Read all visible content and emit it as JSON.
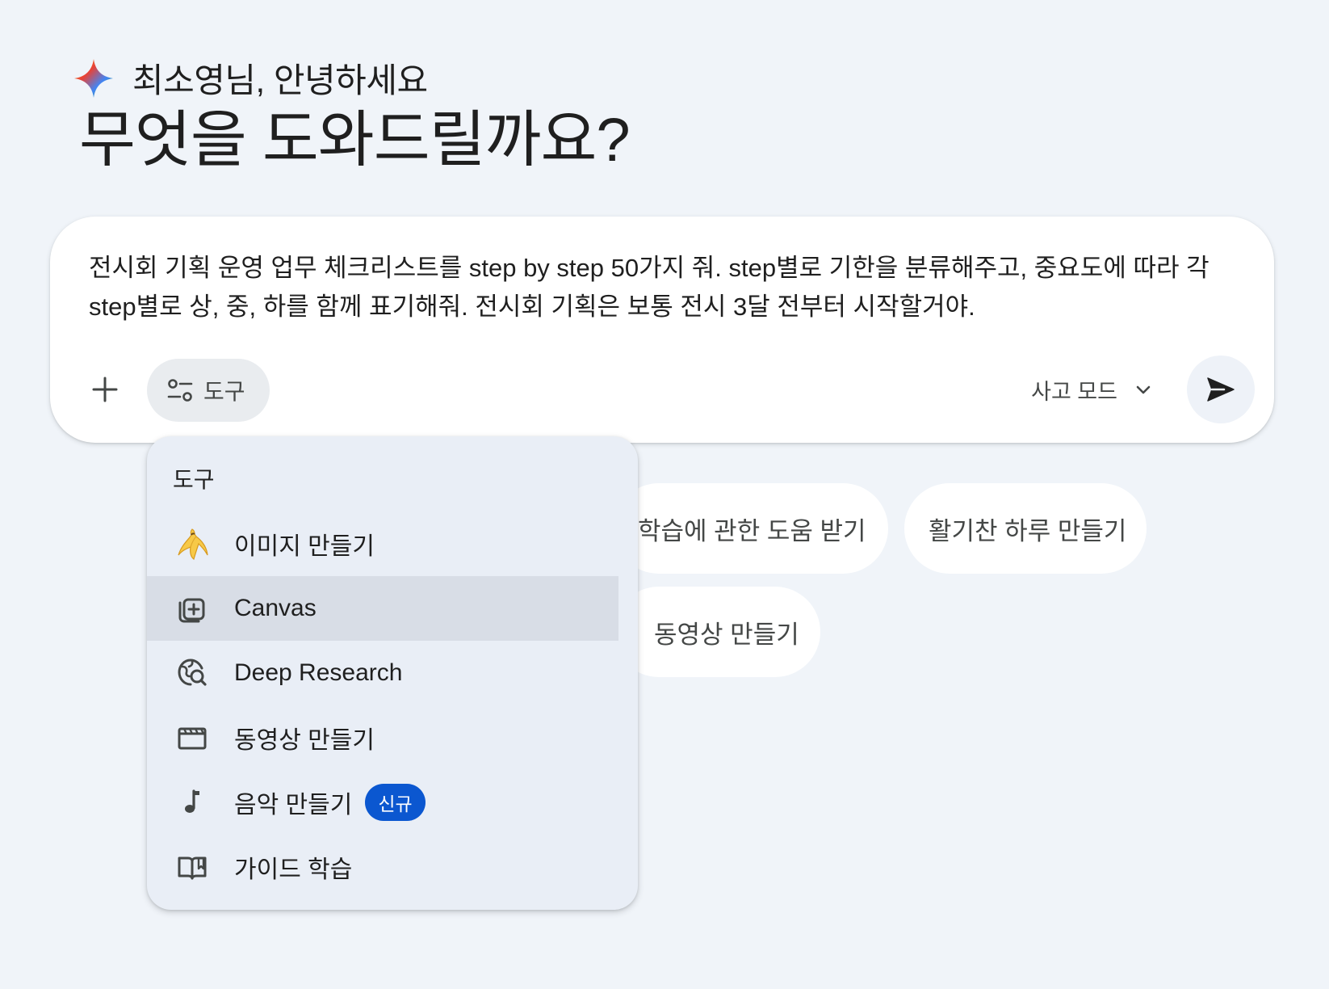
{
  "greeting": {
    "name_line": "최소영님, 안녕하세요",
    "headline": "무엇을 도와드릴까요?"
  },
  "prompt": {
    "text": "전시회 기획 운영 업무 체크리스트를 step by step 50가지 줘. step별로 기한을 분류해주고, 중요도에 따라 각 step별로 상, 중, 하를 함께 표기해줘. 전시회 기획은 보통 전시 3달 전부터 시작할거야."
  },
  "toolbar": {
    "add_icon": "plus-icon",
    "tools_label": "도구",
    "mode_label": "사고 모드",
    "send_icon": "send-icon"
  },
  "suggestions": [
    {
      "label": "학습에 관한 도움 받기"
    },
    {
      "label": "활기찬 하루 만들기"
    },
    {
      "label": "동영상 만들기"
    }
  ],
  "tools_menu": {
    "heading": "도구",
    "items": [
      {
        "label": "이미지 만들기",
        "icon": "banana-icon"
      },
      {
        "label": "Canvas",
        "icon": "canvas-icon",
        "selected": true
      },
      {
        "label": "Deep Research",
        "icon": "globe-search-icon"
      },
      {
        "label": "동영상 만들기",
        "icon": "clapperboard-icon"
      },
      {
        "label": "음악 만들기",
        "icon": "music-note-icon",
        "badge": "신규"
      },
      {
        "label": "가이드 학습",
        "icon": "open-book-icon"
      }
    ]
  },
  "colors": {
    "background": "#f0f4f9",
    "badge": "#0b57d0",
    "menu_background": "#e9eef6",
    "menu_selected": "#d8dde6"
  }
}
